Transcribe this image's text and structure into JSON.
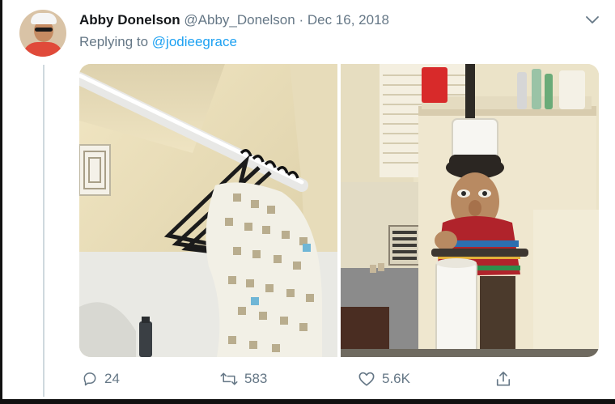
{
  "tweet": {
    "author_name": "Abby Donelson",
    "author_handle": "@Abby_Donelson",
    "separator": "·",
    "date": "Dec 16, 2018",
    "replying_prefix": "Replying to ",
    "replying_to": "@jodieegrace",
    "avatar_icon": "user-avatar",
    "more_icon": "chevron-down-icon"
  },
  "media": {
    "images": [
      {
        "icon": "photo-shower-rod-hangers"
      },
      {
        "icon": "photo-toilet-paper-holder-figurine"
      }
    ]
  },
  "actions": {
    "reply_count": "24",
    "retweet_count": "583",
    "like_count": "5.6K",
    "reply_icon": "reply-icon",
    "retweet_icon": "retweet-icon",
    "like_icon": "heart-icon",
    "share_icon": "share-icon"
  },
  "colors": {
    "accent": "#1da1f2",
    "muted": "#657786",
    "text": "#14171a"
  }
}
